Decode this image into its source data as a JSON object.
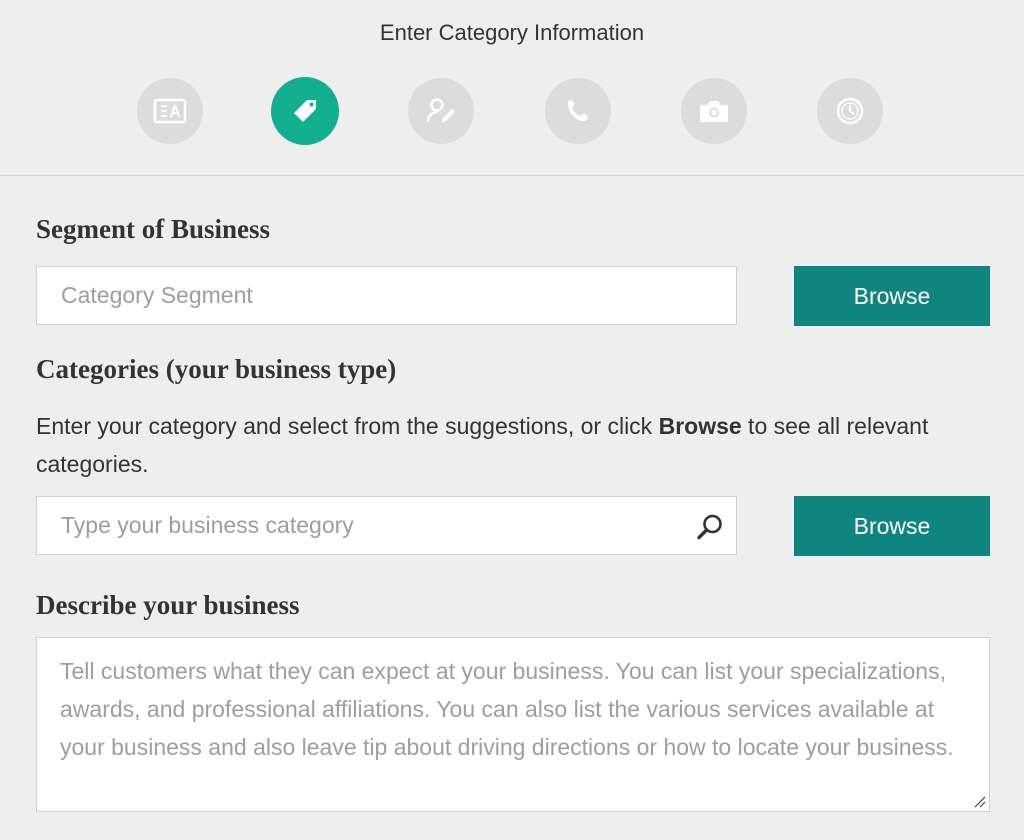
{
  "header": {
    "title": "Enter Category Information",
    "steps": [
      {
        "icon": "id-card-icon",
        "active": false
      },
      {
        "icon": "tag-icon",
        "active": true
      },
      {
        "icon": "user-edit-icon",
        "active": false
      },
      {
        "icon": "phone-icon",
        "active": false
      },
      {
        "icon": "camera-icon",
        "active": false
      },
      {
        "icon": "clock-icon",
        "active": false
      }
    ]
  },
  "colors": {
    "accent_active_step": "#13b08f",
    "button": "#0f8580",
    "inactive_step": "#dcdcdc",
    "background": "#eeeeee"
  },
  "segment": {
    "title": "Segment of Business",
    "placeholder": "Category Segment",
    "value": "",
    "browse_label": "Browse"
  },
  "categories": {
    "title": "Categories (your business type)",
    "helper_before": "Enter your category and select from the suggestions, or click ",
    "helper_bold": "Browse",
    "helper_after": " to see all relevant categories.",
    "placeholder": "Type your business category",
    "value": "",
    "search_icon": "search-icon",
    "browse_label": "Browse"
  },
  "description": {
    "title": "Describe your business",
    "placeholder": "Tell customers what they can expect at your business. You can list your specializations, awards, and professional affiliations. You can also list the various services available at your business and also leave tip about driving directions or how to locate your business.",
    "value": ""
  }
}
